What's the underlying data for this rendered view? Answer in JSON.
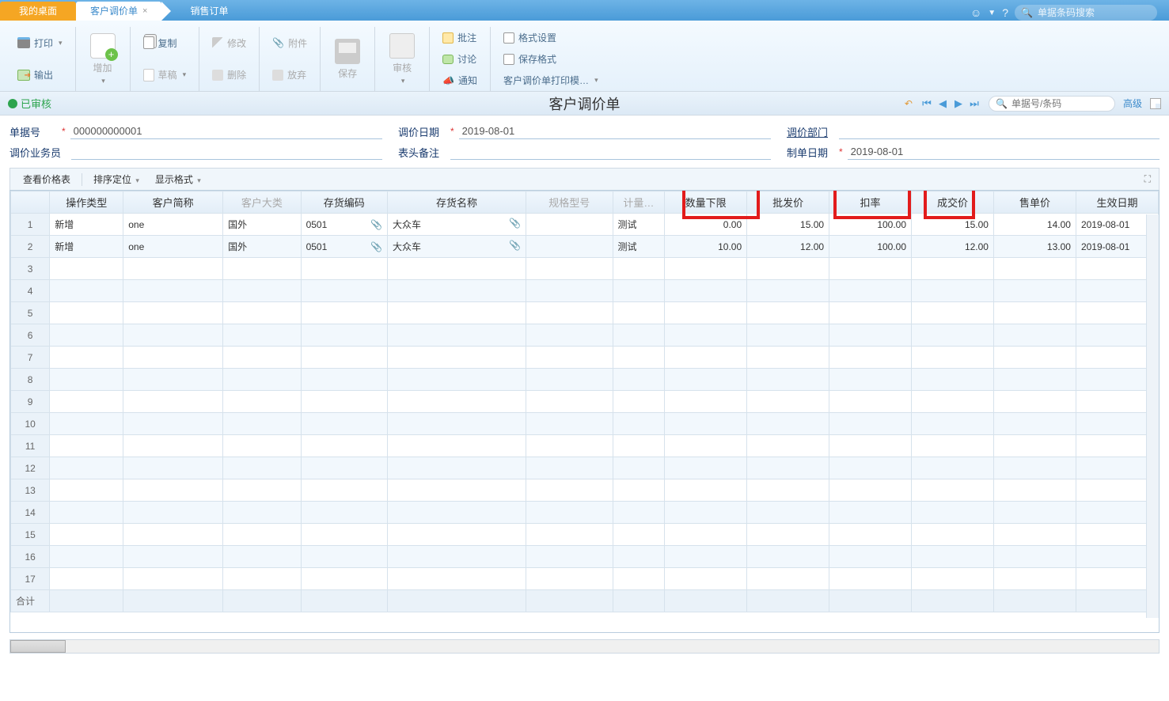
{
  "tabs": {
    "desktop": "我的桌面",
    "active": "客户调价单",
    "third": "销售订单"
  },
  "topSearch": {
    "placeholder": "单据条码搜索"
  },
  "ribbon": {
    "print": "打印",
    "export": "输出",
    "add": "增加",
    "copy": "复制",
    "modify": "修改",
    "attachment": "附件",
    "draft": "草稿",
    "delete": "删除",
    "abandon": "放弃",
    "save": "保存",
    "audit": "审核",
    "batchNote": "批注",
    "discuss": "讨论",
    "notify": "通知",
    "formatSet": "格式设置",
    "saveFormat": "保存格式",
    "printTpl": "客户调价单打印模…"
  },
  "titlebar": {
    "status": "已审核",
    "title": "客户调价单",
    "searchPlaceholder": "单据号/条码",
    "advanced": "高级"
  },
  "form": {
    "billNo": {
      "label": "单据号",
      "value": "000000000001"
    },
    "adjustDate": {
      "label": "调价日期",
      "value": "2019-08-01"
    },
    "dept": {
      "label": "调价部门",
      "value": ""
    },
    "salesman": {
      "label": "调价业务员",
      "value": ""
    },
    "headerNote": {
      "label": "表头备注",
      "value": ""
    },
    "makeDate": {
      "label": "制单日期",
      "value": "2019-08-01"
    }
  },
  "subToolbar": {
    "viewPrice": "查看价格表",
    "sortLocate": "排序定位",
    "displayFmt": "显示格式"
  },
  "table": {
    "headers": {
      "opType": "操作类型",
      "custShort": "客户简称",
      "custClass": "客户大类",
      "stockCode": "存货编码",
      "stockName": "存货名称",
      "spec": "规格型号",
      "unit": "计量…",
      "qtyLower": "数量下限",
      "wholesale": "批发价",
      "discount": "扣率",
      "dealPrice": "成交价",
      "retail": "售单价",
      "effectDate": "生效日期"
    },
    "rows": [
      {
        "opType": "新增",
        "custShort": "one",
        "custClass": "国外",
        "stockCode": "0501",
        "stockName": "大众车",
        "spec": "",
        "unit": "测试",
        "qtyLower": "0.00",
        "wholesale": "15.00",
        "discount": "100.00",
        "dealPrice": "15.00",
        "retail": "14.00",
        "effectDate": "2019-08-01"
      },
      {
        "opType": "新增",
        "custShort": "one",
        "custClass": "国外",
        "stockCode": "0501",
        "stockName": "大众车",
        "spec": "",
        "unit": "测试",
        "qtyLower": "10.00",
        "wholesale": "12.00",
        "discount": "100.00",
        "dealPrice": "12.00",
        "retail": "13.00",
        "effectDate": "2019-08-01"
      }
    ],
    "totalLabel": "合计",
    "emptyRows": 15
  }
}
